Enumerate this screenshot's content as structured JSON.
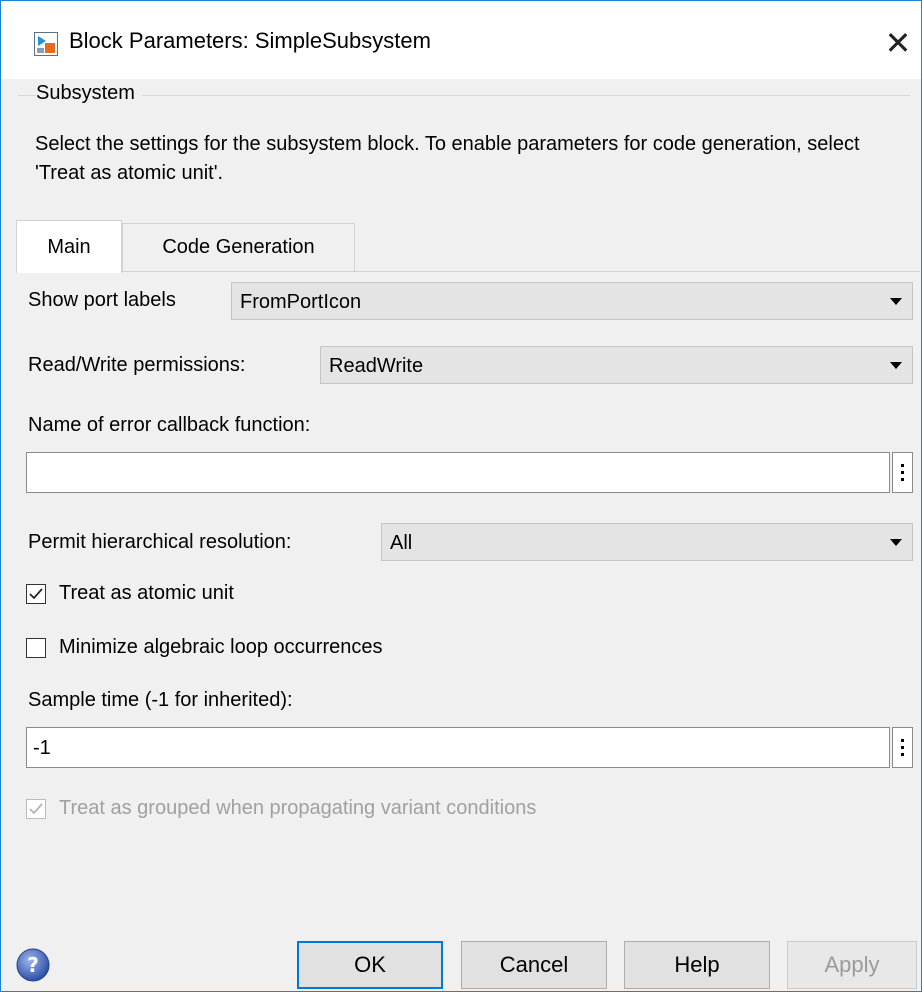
{
  "window": {
    "title": "Block Parameters: SimpleSubsystem",
    "close_glyph": "✕"
  },
  "group": {
    "label": "Subsystem",
    "description": "Select the settings for the subsystem block. To enable parameters for code generation, select 'Treat as atomic unit'."
  },
  "tabs": [
    {
      "label": "Main",
      "active": true
    },
    {
      "label": "Code Generation",
      "active": false
    }
  ],
  "main": {
    "show_port_labels": {
      "label": "Show port labels",
      "value": "FromPortIcon"
    },
    "read_write_permissions": {
      "label": "Read/Write permissions:",
      "value": "ReadWrite"
    },
    "error_callback": {
      "label": "Name of error callback function:",
      "value": ""
    },
    "hierarchical_resolution": {
      "label": "Permit hierarchical resolution:",
      "value": "All"
    },
    "treat_as_atomic": {
      "label": "Treat as atomic unit",
      "checked": true
    },
    "minimize_loop": {
      "label": "Minimize algebraic loop occurrences",
      "checked": false
    },
    "sample_time": {
      "label": "Sample time (-1 for inherited):",
      "value": "-1"
    },
    "treat_as_grouped": {
      "label": "Treat as grouped when propagating variant conditions",
      "checked": true,
      "enabled": false
    }
  },
  "buttons": {
    "ok": "OK",
    "cancel": "Cancel",
    "help": "Help",
    "apply": "Apply"
  },
  "icons": {
    "app": "simulink-block-icon",
    "help": "help-question-icon",
    "more": "vertical-ellipsis-icon"
  },
  "colors": {
    "accent": "#0078d7",
    "window_border": "#1883d7",
    "background": "#f0f0f0"
  }
}
